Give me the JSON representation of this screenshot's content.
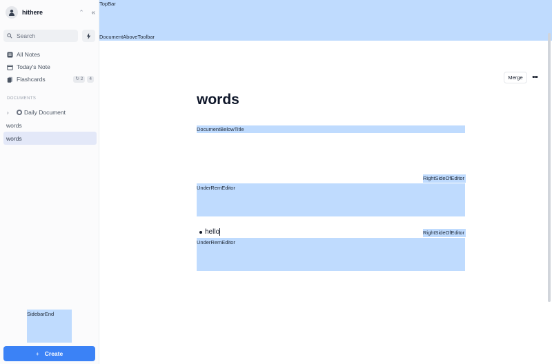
{
  "sidebar": {
    "username": "hithere",
    "search_label": "Search",
    "nav": {
      "all_notes": "All Notes",
      "todays_note": "Today's Note",
      "flashcards": "Flashcards",
      "flashcard_badge_1": "2",
      "flashcard_badge_2": "4"
    },
    "section_label": "DOCUMENTS",
    "documents": {
      "daily": "Daily Document",
      "item_1": "words",
      "item_2": "words"
    },
    "sidebar_end_label": "SidebarEnd",
    "create_label": "Create",
    "create_plus": "+"
  },
  "main": {
    "topbar_label": "TopBar",
    "above_toolbar_label": "DocumentAboveToolbar",
    "merge_label": "Merge",
    "more_label": "•••",
    "title": "words",
    "below_title_label": "DocumentBelowTitle",
    "right_side_label_1": "RightSideOfEditor",
    "under_rem_label_1": "UnderRemEditor",
    "bullet_text": "hello",
    "right_side_label_2": "RightSideOfEditor",
    "under_rem_label_2": "UnderRemEditor"
  },
  "colors": {
    "accent": "#3b82f6",
    "placeholder_blue": "#bfdbfe",
    "active_item": "#e3e8f8"
  },
  "icons": [
    "user-icon",
    "updown-chevron-icon",
    "collapse-sidebar-icon",
    "search-icon",
    "bolt-icon",
    "all-notes-icon",
    "calendar-icon",
    "flashcards-icon",
    "chevron-right-icon",
    "daily-document-icon",
    "plus-icon",
    "more-icon"
  ]
}
